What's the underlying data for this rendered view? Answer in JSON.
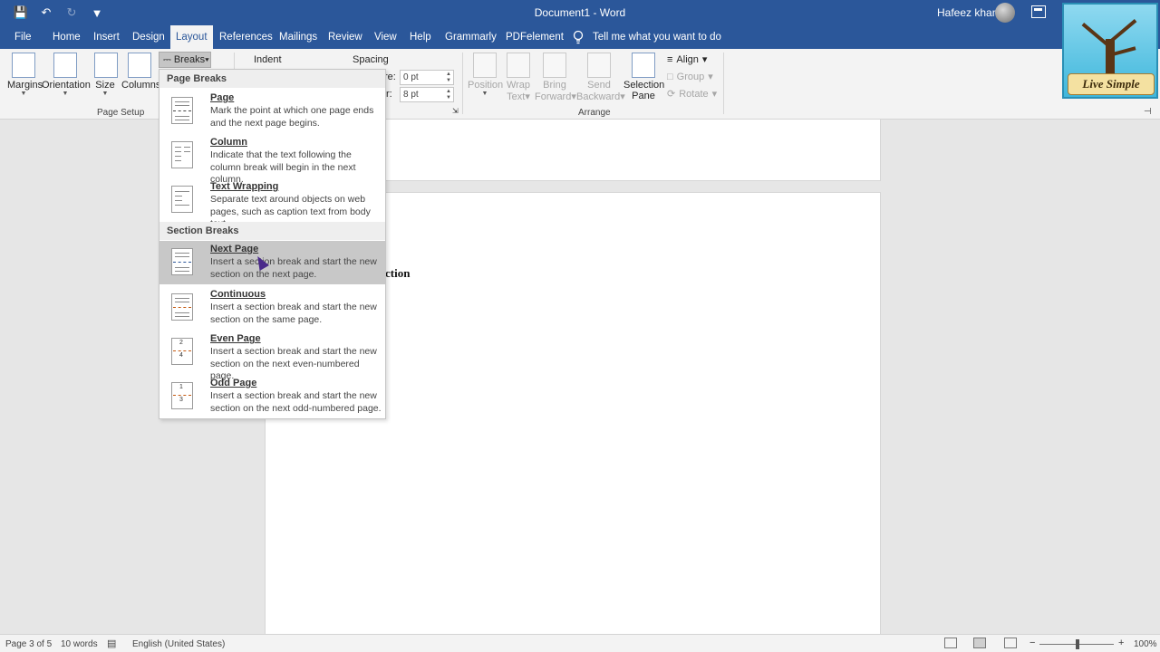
{
  "titlebar": {
    "doc_title": "Document1  -  Word",
    "user": "Hafeez khan"
  },
  "tabs": [
    {
      "label": "File"
    },
    {
      "label": "Home"
    },
    {
      "label": "Insert"
    },
    {
      "label": "Design"
    },
    {
      "label": "Layout"
    },
    {
      "label": "References"
    },
    {
      "label": "Mailings"
    },
    {
      "label": "Review"
    },
    {
      "label": "View"
    },
    {
      "label": "Help"
    },
    {
      "label": "Grammarly"
    },
    {
      "label": "PDFelement"
    }
  ],
  "active_tab": "Layout",
  "tellme": "Tell me what you want to do",
  "ribbon": {
    "margins": "Margins",
    "orientation": "Orientation",
    "size": "Size",
    "columns": "Columns",
    "page_setup_label": "Page Setup",
    "breaks": "Breaks",
    "indent": "Indent",
    "spacing": "Spacing",
    "before_label": "re:",
    "before_value": "0 pt",
    "after_label": "r:",
    "after_value": "8 pt",
    "position": "Position",
    "wrap_text_1": "Wrap",
    "wrap_text_2": "Text",
    "bring_forward_1": "Bring",
    "bring_forward_2": "Forward",
    "send_backward_1": "Send",
    "send_backward_2": "Backward",
    "selection_pane_1": "Selection",
    "selection_pane_2": "Pane",
    "align": "Align",
    "group": "Group",
    "rotate": "Rotate",
    "arrange_label": "Arrange"
  },
  "logo_text": "Live Simple",
  "breaks_menu": {
    "page_breaks_header": "Page Breaks",
    "section_breaks_header": "Section Breaks",
    "items": [
      {
        "title": "Page",
        "desc": "Mark the point at which one page ends and the next page begins."
      },
      {
        "title": "Column",
        "desc": "Indicate that the text following the column break will begin in the next column."
      },
      {
        "title": "Text Wrapping",
        "desc": "Separate text around objects on web pages, such as caption text from body text."
      },
      {
        "title": "Next Page",
        "desc": "Insert a section break and start the new section on the next page."
      },
      {
        "title": "Continuous",
        "desc": "Insert a section break and start the new section on the same page."
      },
      {
        "title": "Even Page",
        "desc": "Insert a section break and start the new section on the next even-numbered page."
      },
      {
        "title": "Odd Page",
        "desc": "Insert a section break and start the new section on the next odd-numbered page."
      }
    ]
  },
  "document": {
    "visible_text": "ction"
  },
  "statusbar": {
    "page": "Page 3 of 5",
    "words": "10 words",
    "language": "English (United States)",
    "zoom": "100%",
    "zoom_minus": "−",
    "zoom_plus": "+"
  }
}
